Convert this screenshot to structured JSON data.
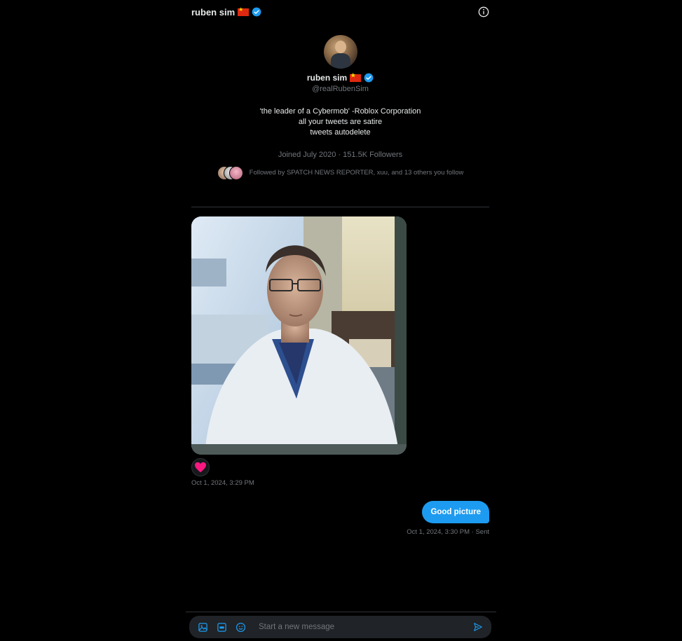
{
  "header": {
    "name": "ruben sim"
  },
  "profile": {
    "name": "ruben sim",
    "handle": "@realRubenSim",
    "bio": [
      "'the leader of a Cybermob' -Roblox Corporation",
      "all your tweets are satire",
      "tweets autodelete"
    ],
    "joined": "Joined July 2020 · 151.5K Followers",
    "followed_by": "Followed by SPATCH NEWS REPORTER, xuu, and 13 others you follow"
  },
  "messages": {
    "received_timestamp": "Oct 1, 2024, 3:29 PM",
    "sent_text": "Good picture",
    "sent_timestamp": "Oct 1, 2024, 3:30 PM · Sent"
  },
  "composer": {
    "placeholder": "Start a new message"
  },
  "colors": {
    "accent": "#1d9bf0",
    "background": "#000000",
    "muted": "#71767b",
    "heart": "#f91880"
  },
  "icons": [
    "verified-badge-icon",
    "flag-china-icon",
    "info-icon",
    "heart-icon",
    "image-icon",
    "gif-icon",
    "emoji-icon",
    "send-icon"
  ]
}
